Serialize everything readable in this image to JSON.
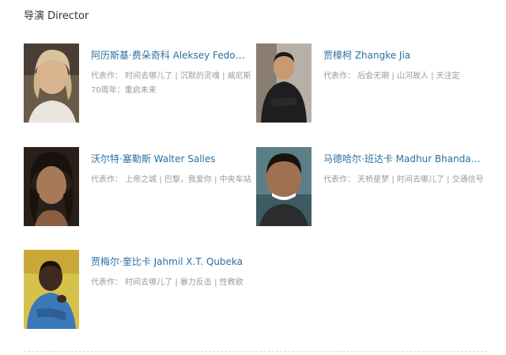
{
  "section": {
    "title": "导演 Director"
  },
  "directors": [
    {
      "name": "阿历斯基·费朵奇科 Aleksey Fedo…",
      "works": "代表作： 时间去哪儿了 | 沉默的灵魂 | 威尼斯70周年：重启未来"
    },
    {
      "name": "贾樟柯 Zhangke Jia",
      "works": "代表作： 后会无期 | 山河故人 | 天注定"
    },
    {
      "name": "沃尔特·塞勒斯 Walter Salles",
      "works": "代表作： 上帝之城 | 巴黎，我爱你 | 中央车站"
    },
    {
      "name": "马德哈尔·班达卡 Madhur Bhanda…",
      "works": "代表作： 天桥星梦 | 时间去哪儿了 | 交通信号"
    },
    {
      "name": "贾梅尔·奎比卡 Jahmil X.T. Qubeka",
      "works": "代表作： 时间去哪儿了 | 暴力反击 | 性教欲"
    }
  ]
}
